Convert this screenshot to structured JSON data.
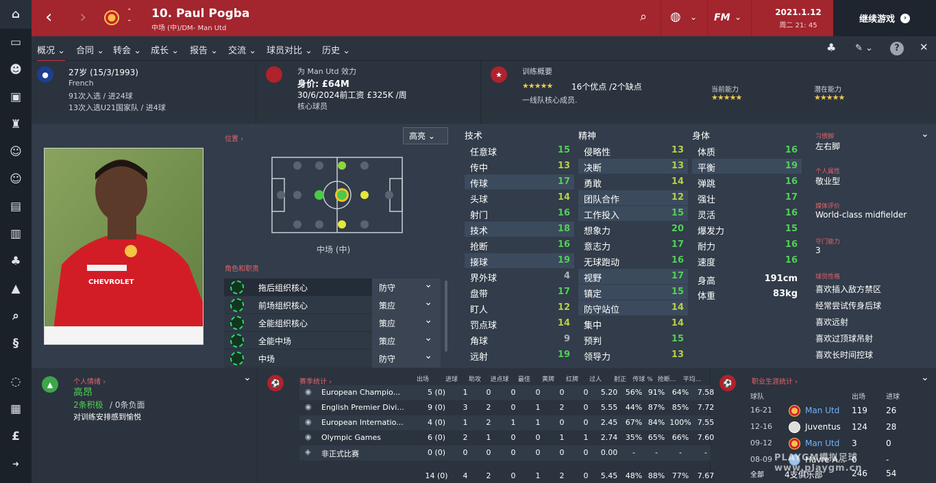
{
  "header": {
    "name": "10. Paul Pogba",
    "position": "中场 (中)/DM- Man Utd",
    "date": "2021.1.12",
    "time": "周二 21: 45",
    "continue": "继续游戏",
    "logo": "FM"
  },
  "tabs": [
    "概况",
    "合同",
    "转会",
    "成长",
    "报告",
    "交流",
    "球员对比",
    "历史"
  ],
  "info": {
    "age": "27岁 (15/3/1993)",
    "nationality": "French",
    "caps": "91次入选 / 进24球",
    "u21": "13次入选U21国家队 / 进4球",
    "club": "为 Man Utd 效力",
    "value": "身价: £64M",
    "contract": "30/6/2024前工资 £325K /周",
    "status": "核心球员",
    "training": "训练概要",
    "train_summary": "16个优点 /2个缺点",
    "squad": "一线队核心成员.",
    "current": "当前能力",
    "potential": "潜在能力"
  },
  "position_panel": {
    "link": "位置",
    "highlight": "高亮",
    "label": "中场 (中)",
    "roles_link": "角色和职责"
  },
  "roles": [
    {
      "name": "拖后组织核心",
      "duty": "防守"
    },
    {
      "name": "前场组织核心",
      "duty": "策应"
    },
    {
      "name": "全能组织核心",
      "duty": "策应"
    },
    {
      "name": "全能中场",
      "duty": "策应"
    },
    {
      "name": "中场",
      "duty": "防守"
    }
  ],
  "headings": {
    "tech": "技术",
    "mental": "精神",
    "physical": "身体"
  },
  "technical": [
    [
      "任意球",
      "15"
    ],
    [
      "传中",
      "13"
    ],
    [
      "传球",
      "17"
    ],
    [
      "头球",
      "14"
    ],
    [
      "射门",
      "16"
    ],
    [
      "技术",
      "18"
    ],
    [
      "抢断",
      "16"
    ],
    [
      "接球",
      "19"
    ],
    [
      "界外球",
      "4"
    ],
    [
      "盘带",
      "17"
    ],
    [
      "盯人",
      "12"
    ],
    [
      "罚点球",
      "14"
    ],
    [
      "角球",
      "9"
    ],
    [
      "远射",
      "19"
    ]
  ],
  "mental": [
    [
      "侵略性",
      "13"
    ],
    [
      "决断",
      "13"
    ],
    [
      "勇敢",
      "14"
    ],
    [
      "团队合作",
      "12"
    ],
    [
      "工作投入",
      "15"
    ],
    [
      "想象力",
      "20"
    ],
    [
      "意志力",
      "17"
    ],
    [
      "无球跑动",
      "16"
    ],
    [
      "视野",
      "17"
    ],
    [
      "镇定",
      "15"
    ],
    [
      "防守站位",
      "14"
    ],
    [
      "集中",
      "14"
    ],
    [
      "预判",
      "15"
    ],
    [
      "领导力",
      "13"
    ]
  ],
  "physical": [
    [
      "体质",
      "16"
    ],
    [
      "平衡",
      "19"
    ],
    [
      "弹跳",
      "16"
    ],
    [
      "强壮",
      "17"
    ],
    [
      "灵活",
      "16"
    ],
    [
      "爆发力",
      "15"
    ],
    [
      "耐力",
      "16"
    ],
    [
      "速度",
      "16"
    ]
  ],
  "body": {
    "h_label": "身高",
    "height": "191cm",
    "w_label": "体重",
    "weight": "83kg"
  },
  "traits": {
    "foot_l": "习惯脚",
    "foot": "左右脚",
    "pers_l": "个人属性",
    "pers": "敬业型",
    "media_l": "媒体评价",
    "media": "World-class midfielder",
    "gk_l": "守门能力",
    "gk": "3",
    "style_l": "球员性格",
    "styles": [
      "喜欢插入敌方禁区",
      "经常尝试传身后球",
      "喜欢远射",
      "喜欢过顶球吊射",
      "喜欢长时间控球"
    ]
  },
  "morale": {
    "link": "个人情绪",
    "value": "高昂",
    "pos": "2条积极",
    "neg": "/ 0条负面",
    "note": "对训练安排感到愉悦"
  },
  "season": {
    "link": "赛季统计",
    "headers": [
      "出场",
      "进球",
      "助攻",
      "进点球",
      "最佳",
      "黄牌",
      "红牌",
      "过人",
      "射正",
      "传球 %",
      "抢断...",
      "平均..."
    ],
    "rows": [
      [
        "European Champio...",
        "5 (0)",
        "1",
        "0",
        "0",
        "0",
        "0",
        "0",
        "5.20",
        "56%",
        "91%",
        "64%",
        "7.58"
      ],
      [
        "English Premier Divi...",
        "9 (0)",
        "3",
        "2",
        "0",
        "1",
        "2",
        "0",
        "5.55",
        "44%",
        "87%",
        "85%",
        "7.72"
      ],
      [
        "European Internatio...",
        "4 (0)",
        "1",
        "2",
        "1",
        "1",
        "0",
        "0",
        "2.45",
        "67%",
        "84%",
        "100%",
        "7.55"
      ],
      [
        "Olympic Games",
        "6 (0)",
        "2",
        "1",
        "0",
        "0",
        "1",
        "1",
        "2.74",
        "35%",
        "65%",
        "66%",
        "7.60"
      ],
      [
        "非正式比赛",
        "0 (0)",
        "0",
        "0",
        "0",
        "0",
        "0",
        "0",
        "0.00",
        "-",
        "-",
        "-",
        "-"
      ]
    ],
    "total": [
      "14 (0)",
      "4",
      "2",
      "0",
      "1",
      "2",
      "0",
      "5.45",
      "48%",
      "88%",
      "77%",
      "7.67"
    ]
  },
  "career": {
    "link": "职业生涯统计",
    "h_team": "球队",
    "h_apps": "出场",
    "h_goals": "进球",
    "rows": [
      [
        "16-21",
        "Man Utd",
        "119",
        "26"
      ],
      [
        "12-16",
        "Juventus",
        "124",
        "28"
      ],
      [
        "09-12",
        "Man Utd",
        "3",
        "0"
      ],
      [
        "08-09",
        "Havre A...",
        "0",
        "-"
      ]
    ],
    "total": [
      "全部",
      "4支俱乐部",
      "246",
      "54"
    ]
  },
  "watermark": "PLAYGM模拟足球 www.playgm.cn"
}
